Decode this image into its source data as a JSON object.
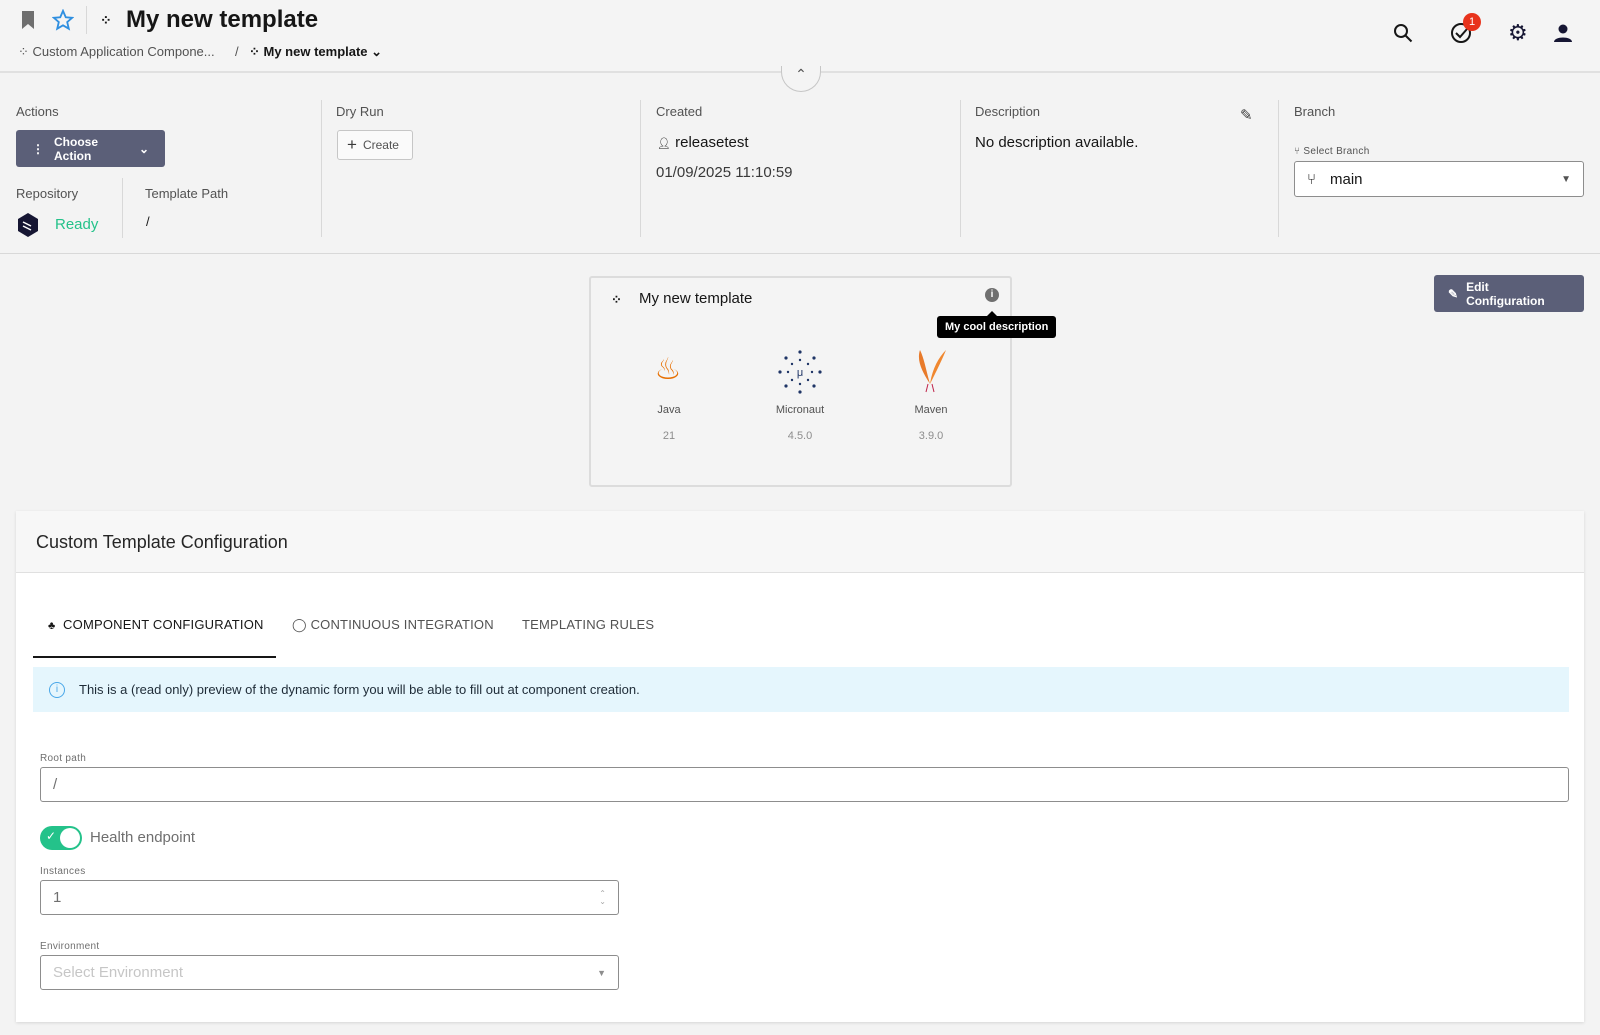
{
  "header": {
    "title": "My new template",
    "breadcrumb_parent": "Custom Application Compone...",
    "breadcrumb_separator": "/",
    "breadcrumb_current": "My new template",
    "notification_count": "1"
  },
  "info": {
    "actions_label": "Actions",
    "choose_action": "Choose Action",
    "repository_label": "Repository",
    "repository_status": "Ready",
    "template_path_label": "Template Path",
    "template_path": "/",
    "dry_run_label": "Dry Run",
    "create_label": "Create",
    "created_label": "Created",
    "created_by": "releasetest",
    "created_at": "01/09/2025 11:10:59",
    "description_label": "Description",
    "description": "No description available.",
    "branch_label": "Branch",
    "select_branch_label": "Select Branch",
    "branch": "main"
  },
  "card": {
    "title": "My new template",
    "tooltip": "My cool description",
    "techs": [
      {
        "name": "Java",
        "version": "21"
      },
      {
        "name": "Micronaut",
        "version": "4.5.0"
      },
      {
        "name": "Maven",
        "version": "3.9.0"
      }
    ]
  },
  "edit_configuration": "Edit Configuration",
  "config": {
    "title": "Custom Template Configuration",
    "tabs": [
      "COMPONENT CONFIGURATION",
      "CONTINUOUS INTEGRATION",
      "TEMPLATING RULES"
    ],
    "alert": "This is a (read only) preview of the dynamic form you will be able to fill out at component creation.",
    "root_path_label": "Root path",
    "root_path": "/",
    "health_label": "Health endpoint",
    "health_enabled": true,
    "instances_label": "Instances",
    "instances": "1",
    "environment_label": "Environment",
    "environment_placeholder": "Select Environment"
  },
  "colors": {
    "accent": "#5b5f78",
    "success": "#24c28a",
    "badge": "#e8331c"
  }
}
